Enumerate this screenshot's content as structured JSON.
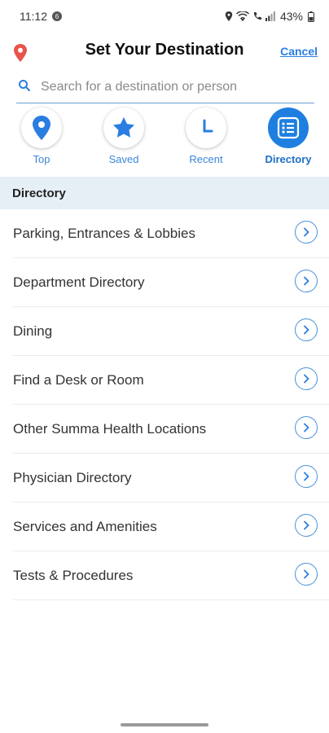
{
  "status": {
    "time": "11:12",
    "badge": "6",
    "battery": "43%"
  },
  "header": {
    "title": "Set Your Destination",
    "cancel_label": "Cancel"
  },
  "search": {
    "placeholder": "Search for a destination or person",
    "value": ""
  },
  "tabs": [
    {
      "label": "Top",
      "icon": "location-pin-icon",
      "active": false
    },
    {
      "label": "Saved",
      "icon": "star-icon",
      "active": false
    },
    {
      "label": "Recent",
      "icon": "clock-icon",
      "active": false
    },
    {
      "label": "Directory",
      "icon": "list-icon",
      "active": true
    }
  ],
  "section": {
    "title": "Directory"
  },
  "list": [
    {
      "label": "Parking, Entrances & Lobbies"
    },
    {
      "label": "Department Directory"
    },
    {
      "label": "Dining"
    },
    {
      "label": "Find a Desk or Room"
    },
    {
      "label": "Other Summa Health Locations"
    },
    {
      "label": "Physician Directory"
    },
    {
      "label": "Services and Amenities"
    },
    {
      "label": "Tests & Procedures"
    }
  ],
  "colors": {
    "accent": "#1f7fe0",
    "pin": "#e8534a",
    "section_bg": "#e6eef6"
  }
}
